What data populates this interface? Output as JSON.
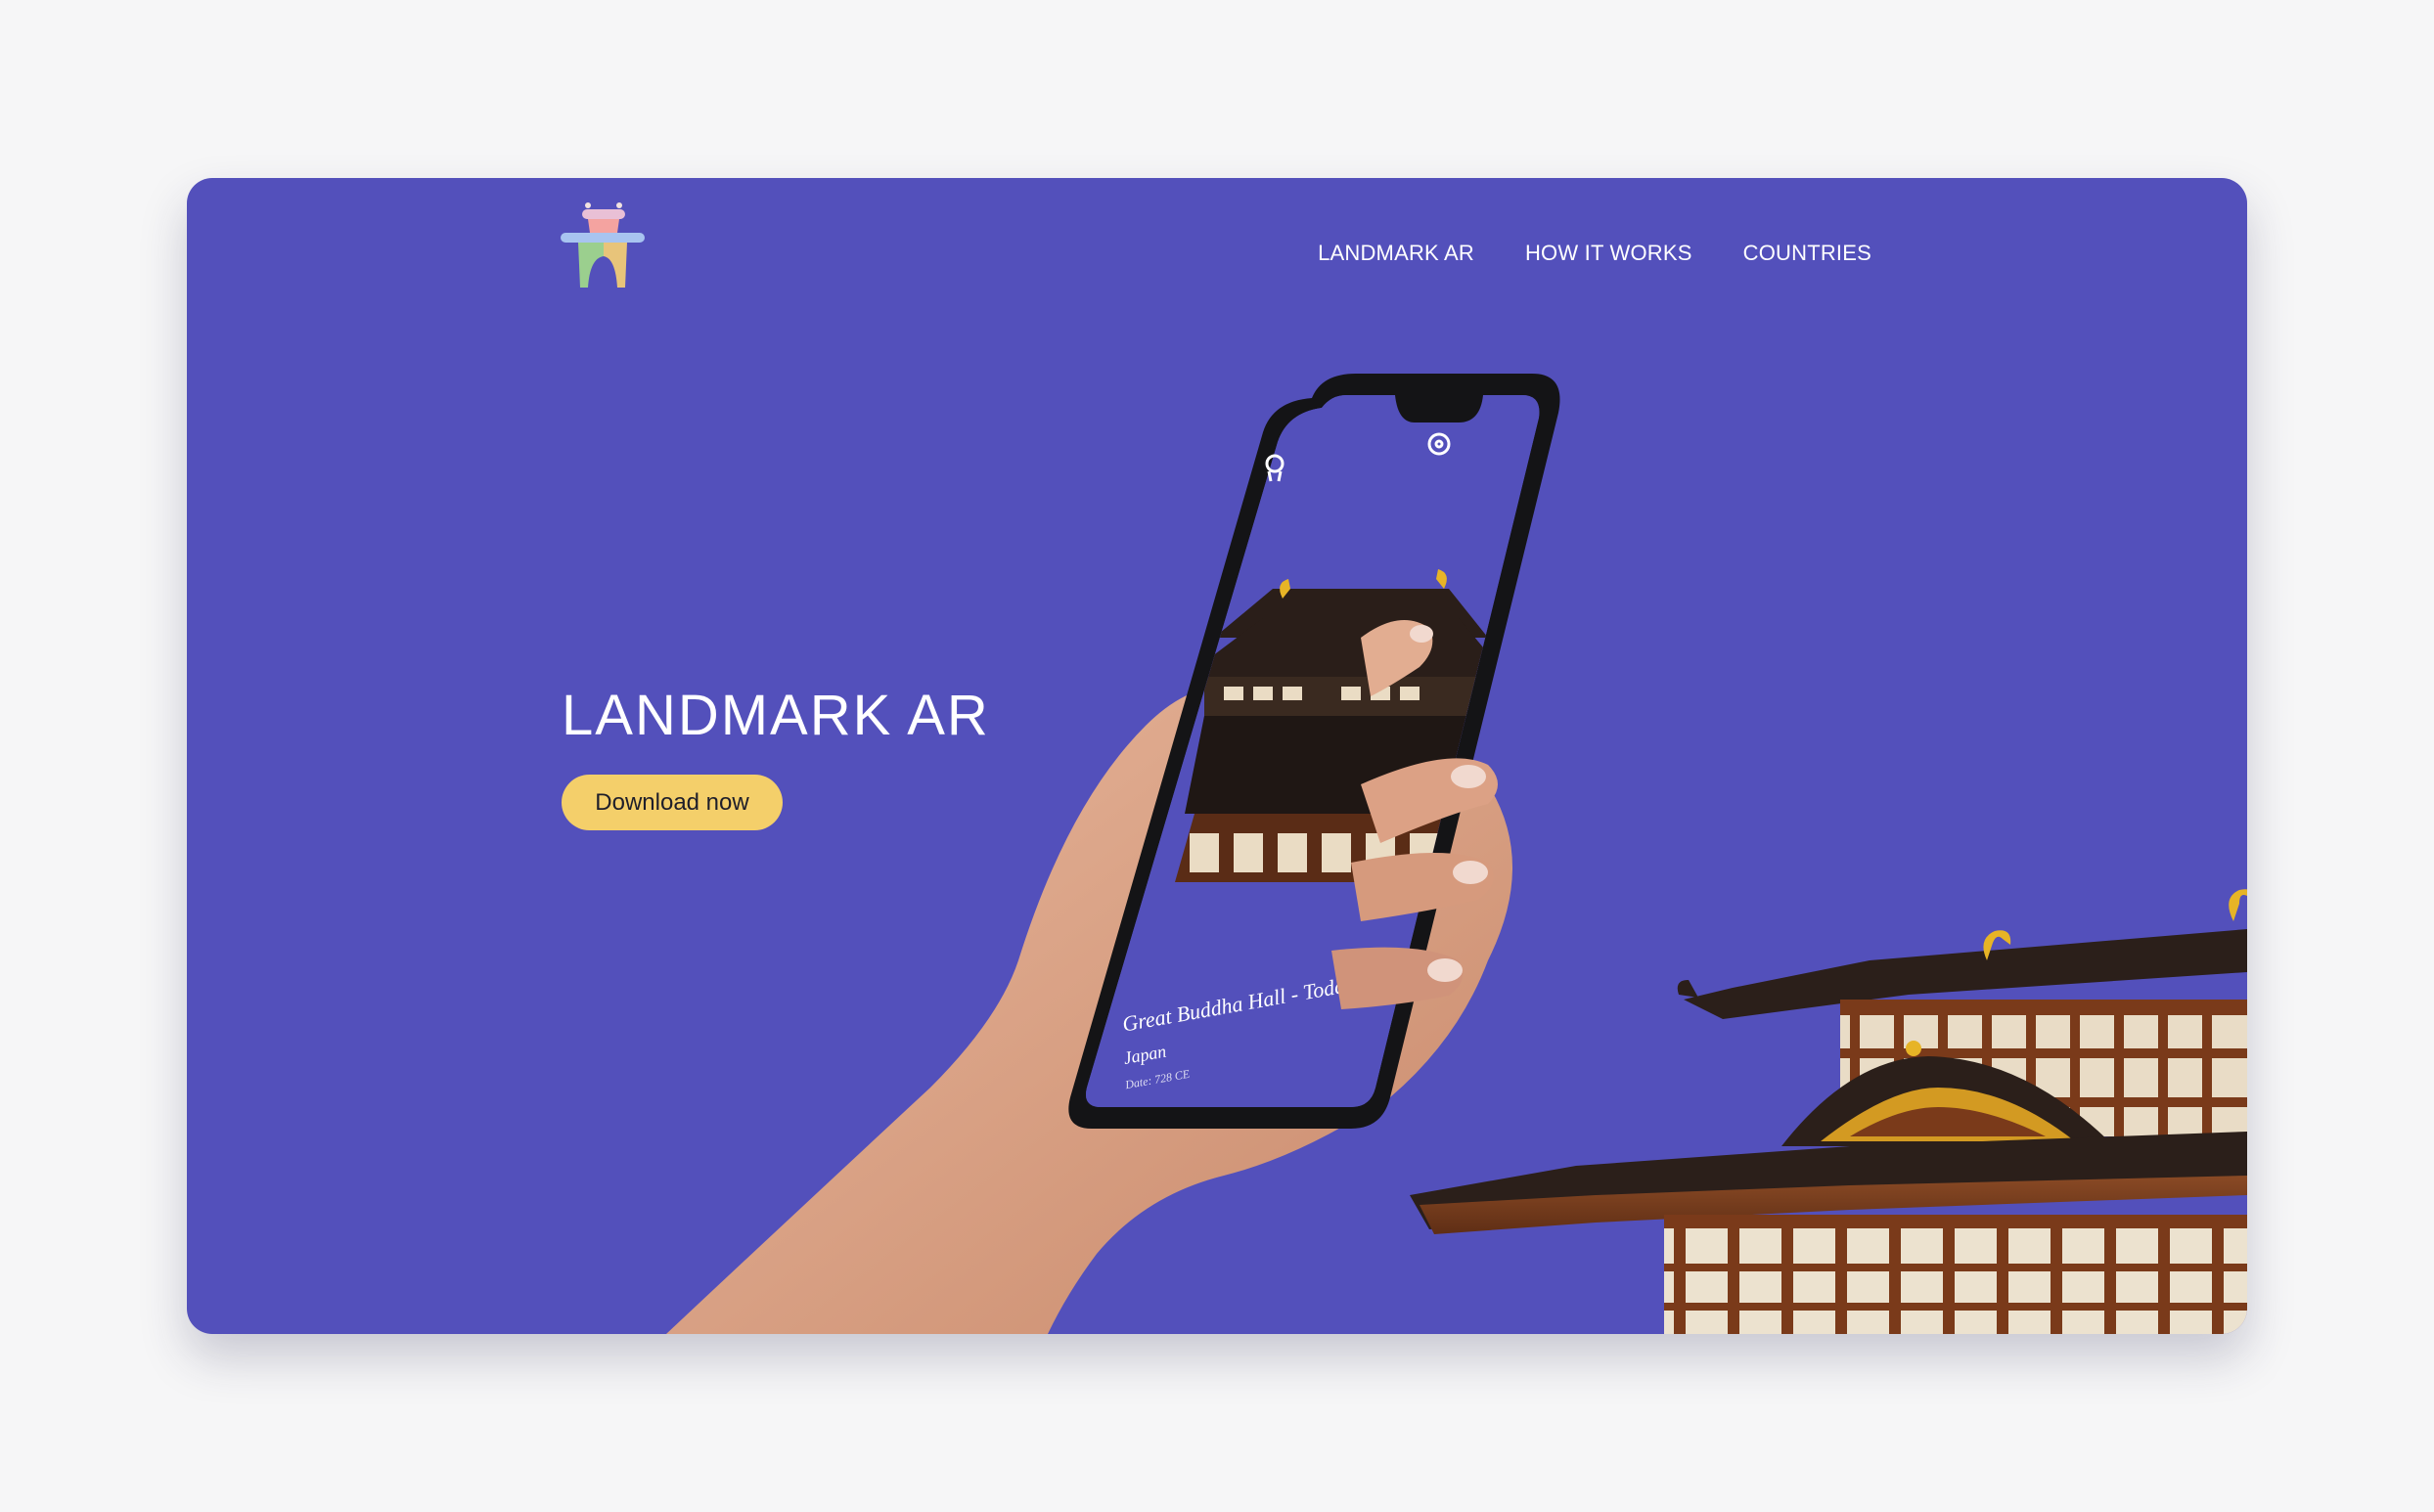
{
  "nav": {
    "items": [
      {
        "label": "LANDMARK AR"
      },
      {
        "label": "HOW IT WORKS"
      },
      {
        "label": "COUNTRIES"
      }
    ]
  },
  "hero": {
    "title": "LANDMARK AR",
    "cta_label": "Download now"
  },
  "phone": {
    "landmark_name": "Great Buddha Hall - Todaiji",
    "country": "Japan",
    "date": "Date: 728 CE",
    "icons": [
      "location-pin-icon",
      "settings-gear-icon"
    ]
  },
  "colors": {
    "background": "#f6f6f7",
    "card": "#5350bb",
    "cta": "#f4cf6a"
  }
}
